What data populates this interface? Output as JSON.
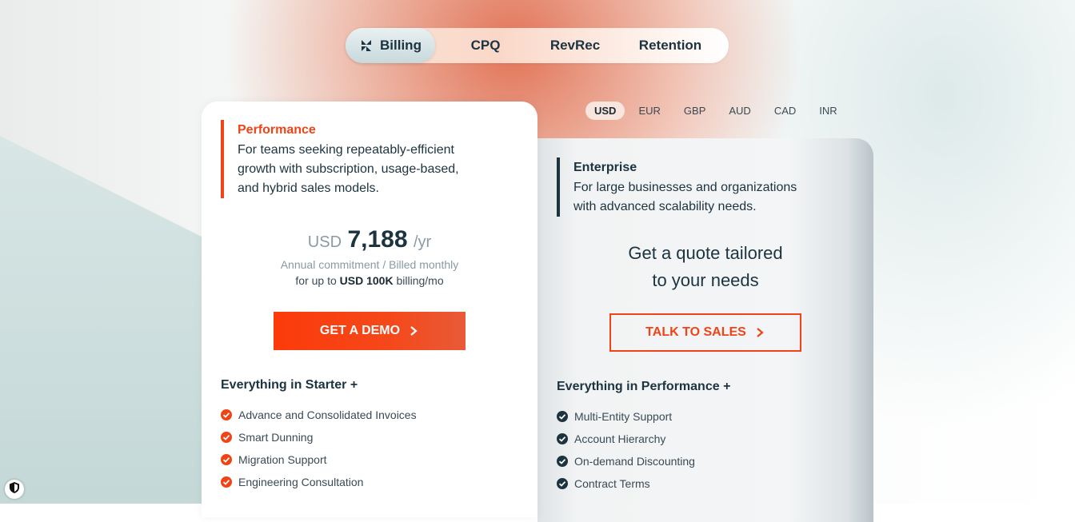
{
  "tabs": [
    {
      "label": "Billing",
      "icon": "billing-logo-icon",
      "active": true
    },
    {
      "label": "CPQ"
    },
    {
      "label": "RevRec"
    },
    {
      "label": "Retention"
    }
  ],
  "currencies": [
    "USD",
    "EUR",
    "GBP",
    "AUD",
    "CAD",
    "INR"
  ],
  "selected_currency": "USD",
  "performance": {
    "name": "Performance",
    "description": "For teams seeking repeatably-efficient growth with subscription, usage-based, and hybrid sales models.",
    "price_currency": "USD",
    "price_amount": "7,188",
    "price_period": "/yr",
    "commitment": "Annual commitment / Billed monthly",
    "limit_prefix": "for up to",
    "limit_value": "USD 100K",
    "limit_suffix": "billing/mo",
    "cta": "GET A DEMO",
    "features_heading": "Everything in Starter +",
    "features": [
      "Advance and Consolidated Invoices",
      "Smart Dunning",
      "Migration Support",
      "Engineering Consultation"
    ]
  },
  "enterprise": {
    "name": "Enterprise",
    "description": "For large businesses and organizations with advanced scalability needs.",
    "quote_line1": "Get a quote tailored",
    "quote_line2": "to your needs",
    "cta": "TALK TO SALES",
    "features_heading": "Everything in Performance +",
    "features": [
      "Multi-Entity Support",
      "Account Hierarchy",
      "On-demand Discounting",
      "Contract Terms"
    ]
  },
  "colors": {
    "accent": "#f04416",
    "navy": "#1c3340"
  }
}
